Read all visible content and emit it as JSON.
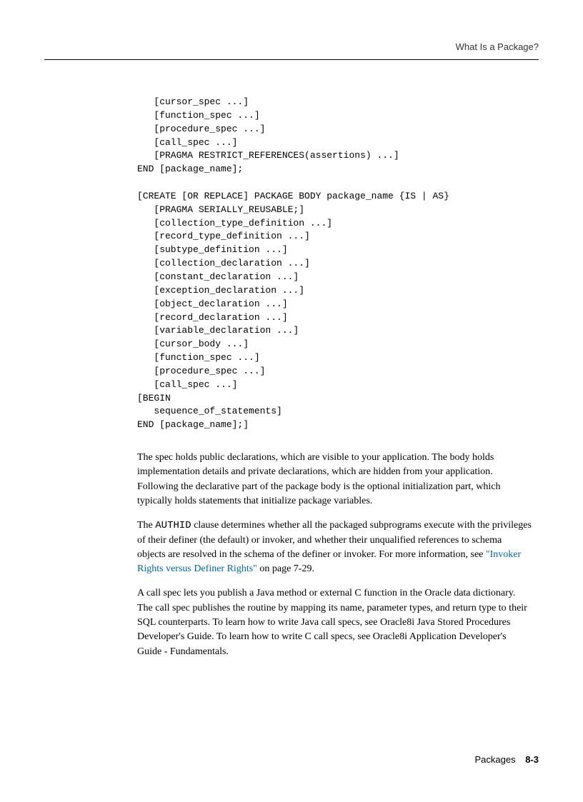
{
  "header": {
    "title": "What Is a Package?"
  },
  "code": {
    "block": "   [cursor_spec ...]\n   [function_spec ...]\n   [procedure_spec ...]\n   [call_spec ...]\n   [PRAGMA RESTRICT_REFERENCES(assertions) ...]\nEND [package_name];\n\n[CREATE [OR REPLACE] PACKAGE BODY package_name {IS | AS}\n   [PRAGMA SERIALLY_REUSABLE;]\n   [collection_type_definition ...]\n   [record_type_definition ...]\n   [subtype_definition ...]\n   [collection_declaration ...]\n   [constant_declaration ...]\n   [exception_declaration ...]\n   [object_declaration ...]\n   [record_declaration ...]\n   [variable_declaration ...]\n   [cursor_body ...]\n   [function_spec ...]\n   [procedure_spec ...]\n   [call_spec ...]\n[BEGIN\n   sequence_of_statements]\nEND [package_name];]"
  },
  "paragraphs": {
    "p1": "The spec holds public declarations, which are visible to your application. The body holds implementation details and private declarations, which are hidden from your application. Following the declarative part of the package body is the optional initialization part, which typically holds statements that initialize package variables.",
    "p2a": "The ",
    "p2code": "AUTHID",
    "p2b": " clause determines whether all the packaged subprograms execute with the privileges of their definer (the default) or invoker, and whether their unqualified references to schema objects are resolved in the schema of the definer or invoker. For more information, see ",
    "p2link": "\"Invoker Rights versus Definer Rights\"",
    "p2c": " on page 7-29.",
    "p3": "A call spec lets you publish a Java method or external C function in the Oracle data dictionary. The call spec publishes the routine by mapping its name, parameter types, and return type to their SQL counterparts. To learn how to write Java call specs, see Oracle8i Java Stored Procedures Developer's Guide. To learn how to write C call specs, see Oracle8i Application Developer's Guide - Fundamentals."
  },
  "footer": {
    "chapter": "Packages",
    "page": "8-3"
  }
}
